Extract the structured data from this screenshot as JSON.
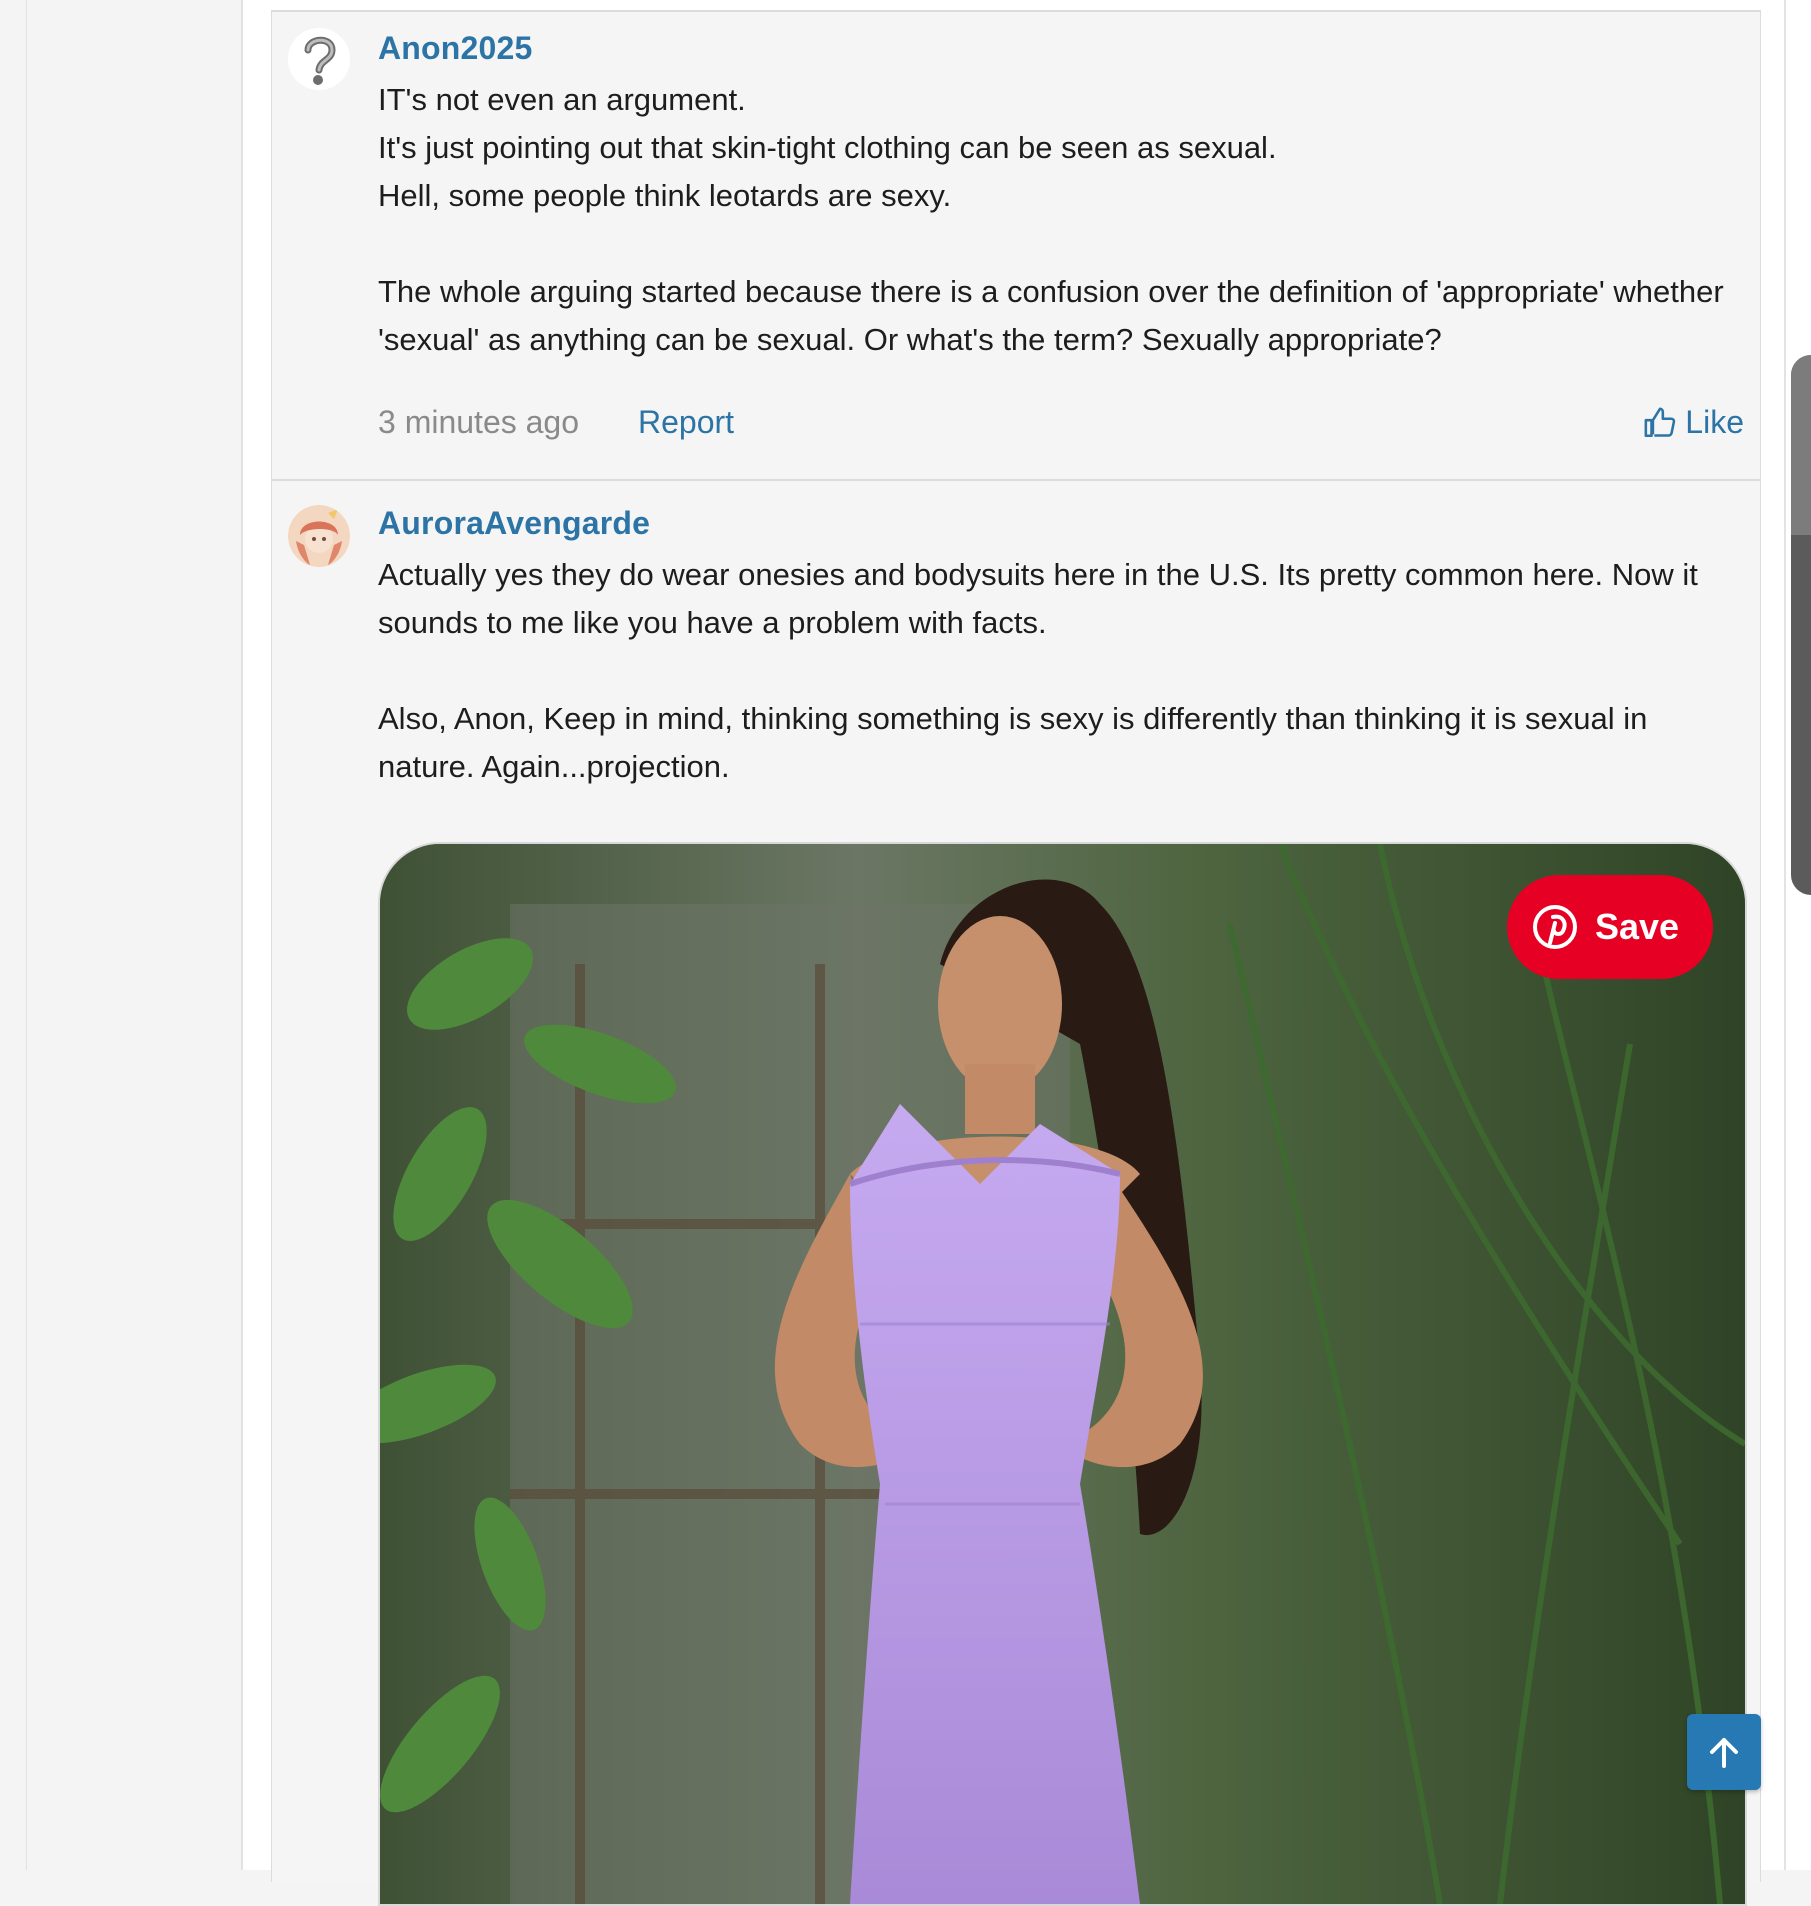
{
  "comments": [
    {
      "username": "Anon2025",
      "avatar_icon": "question-mark-avatar-icon",
      "body": [
        "IT's not even an argument.",
        "It's just pointing out that skin-tight clothing can be seen as sexual.",
        "Hell, some people think leotards are sexy.",
        "",
        "The whole arguing started because there is a confusion over the definition of 'appropriate' whether 'sexual' as anything can be sexual. Or what's the term? Sexually appropriate?"
      ],
      "timestamp": "3 minutes ago",
      "report_label": "Report",
      "like_label": "Like"
    },
    {
      "username": "AuroraAvengarde",
      "avatar_icon": "anime-character-avatar-icon",
      "body": [
        "Actually yes they do wear onesies and bodysuits here in the U.S. Its pretty common here. Now it sounds to me like you have a problem with facts.",
        "",
        "Also, Anon, Keep in mind, thinking something is sexy is differently than thinking it is sexual in nature. Again...projection."
      ],
      "image": {
        "save_label": "Save",
        "save_icon": "pinterest-icon"
      }
    }
  ],
  "colors": {
    "link": "#2d74a6",
    "pinterest": "#e60023",
    "back_to_top": "#2679b3"
  }
}
